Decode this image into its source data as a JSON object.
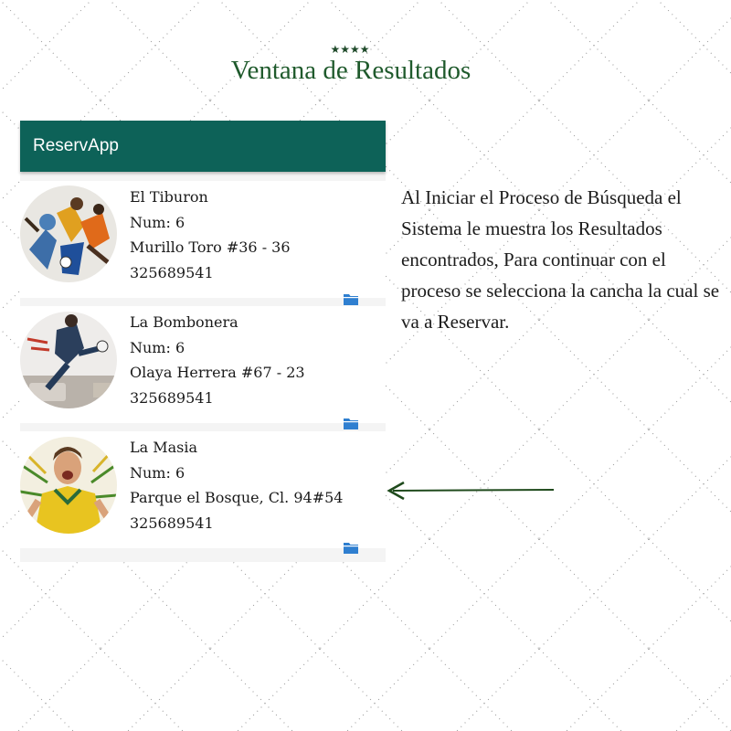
{
  "header": {
    "stars": "★★★★",
    "title": "Ventana de Resultados"
  },
  "app": {
    "name": "ReservApp",
    "results": [
      {
        "name": "El Tiburon",
        "num": "Num: 6",
        "address": "Murillo Toro #36 - 36",
        "phone": "325689541",
        "image": "soccer-players-collage"
      },
      {
        "name": "La Bombonera",
        "num": "Num: 6",
        "address": "Olaya Herrera #67 - 23",
        "phone": "325689541",
        "image": "soccer-player-kick-wall-art"
      },
      {
        "name": "La Masia",
        "num": "Num: 6",
        "address": "Parque el Bosque, Cl. 94#54",
        "phone": "325689541",
        "image": "fan-yellow-jersey-shouting"
      }
    ]
  },
  "description": "Al Iniciar el Proceso de Búsqueda el Sistema le muestra los Resultados encontrados, Para continuar con el proceso se selecciona la cancha la cual se va a Reservar.",
  "icons": {
    "result_action": "folder-icon",
    "pointer": "arrow-left-icon"
  },
  "colors": {
    "appbar": "#0d6258",
    "title": "#1f5a2c",
    "arrow": "#1f4a1c",
    "folder": "#2f7fd0"
  }
}
